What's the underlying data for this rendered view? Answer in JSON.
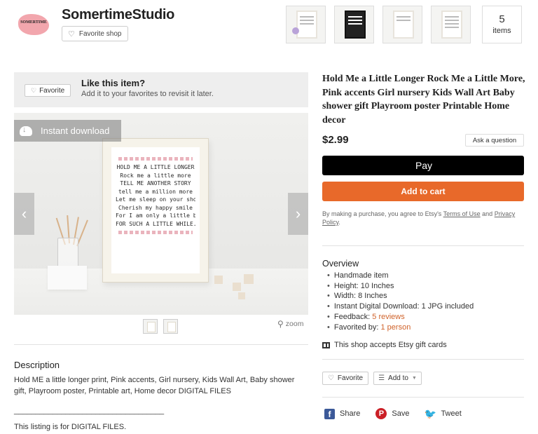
{
  "shop": {
    "logo_text": "SOMERTIME",
    "name": "SomertimeStudio",
    "favorite_shop_label": "Favorite shop",
    "items_count": "5",
    "items_label": "items"
  },
  "like_box": {
    "favorite_label": "Favorite",
    "title": "Like this item?",
    "subtitle": "Add it to your favorites to revisit it later."
  },
  "gallery": {
    "instant_download_label": "Instant download",
    "zoom_label": "zoom",
    "poster_lines": [
      "HOLD ME A LITTLE LONGER",
      "Rock me a little more",
      "TELL ME ANOTHER STORY",
      "tell me a million more",
      "Let me sleep on your shoulder",
      "Cherish my happy smile",
      "For I am only a little baby",
      "FOR SUCH A LITTLE WHILE."
    ]
  },
  "product": {
    "title": "Hold Me a Little Longer Rock Me a Little More, Pink accents Girl nursery Kids Wall Art Baby shower gift Playroom poster Printable Home decor",
    "price": "$2.99",
    "ask_question_label": "Ask a question",
    "applepay_label": "Pay",
    "add_to_cart_label": "Add to cart",
    "terms_prefix": "By making a purchase, you agree to Etsy's ",
    "terms_link": "Terms of Use",
    "terms_middle": " and ",
    "privacy_link": "Privacy Policy",
    "terms_suffix": "."
  },
  "overview": {
    "title": "Overview",
    "items": [
      {
        "text": "Handmade item"
      },
      {
        "text": "Height: 10 Inches"
      },
      {
        "text": "Width: 8 Inches"
      },
      {
        "text": "Instant Digital Download: 1 JPG included"
      },
      {
        "text": "Feedback: ",
        "link": "5 reviews"
      },
      {
        "text": "Favorited by: ",
        "link": "1 person"
      }
    ],
    "gift_cards": "This shop accepts Etsy gift cards"
  },
  "actions": {
    "favorite_label": "Favorite",
    "add_to_label": "Add to"
  },
  "share": {
    "facebook": "Share",
    "pinterest": "Save",
    "twitter": "Tweet"
  },
  "description": {
    "title": "Description",
    "body": "Hold ME a little longer print, Pink accents, Girl nursery, Kids Wall Art, Baby shower gift, Playroom poster, Printable art, Home decor DIGITAL FILES",
    "rule": "___________________________________",
    "more": "This listing is for DIGITAL FILES."
  },
  "colors": {
    "add_to_cart": "#e8692a",
    "applepay": "#000000",
    "link": "#d0632b",
    "facebook": "#3b5998",
    "pinterest": "#cb2027",
    "twitter": "#1da1f2"
  }
}
